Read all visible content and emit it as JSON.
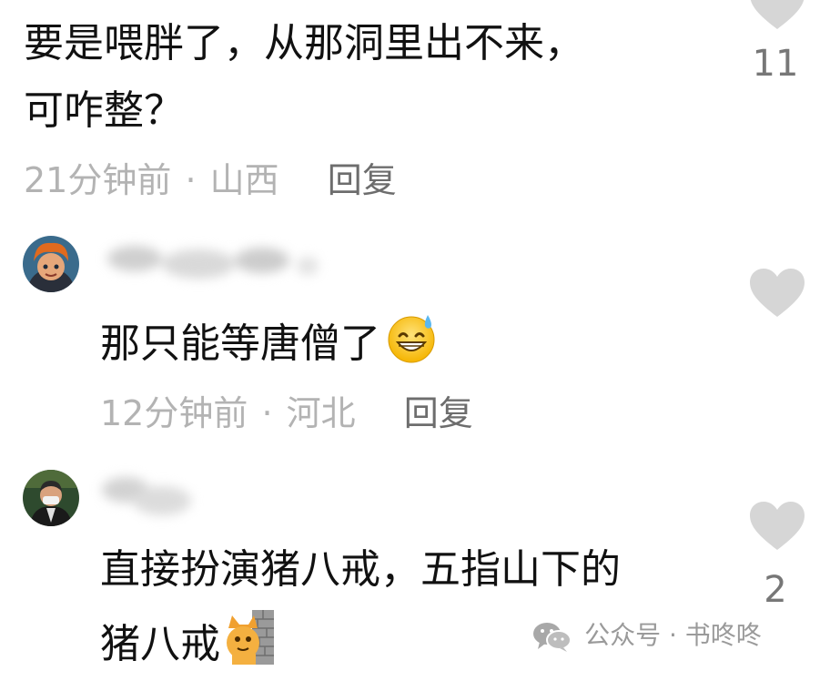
{
  "comments": [
    {
      "line1": "要是喂胖了，从那洞里出不来，",
      "line2": "可咋整？",
      "time": "21分钟前",
      "location": "山西",
      "reply_label": "回复",
      "likes": "11"
    },
    {
      "line1": "那只能等唐僧了",
      "emoji": "grinning-sweat-emoji",
      "time": "12分钟前",
      "location": "河北",
      "reply_label": "回复"
    },
    {
      "line1": "直接扮演猪八戒，五指山下的",
      "line2": "猪八戒",
      "emoji": "cat-behind-wall-emoji",
      "likes": "2"
    }
  ],
  "separator": "·",
  "watermark": {
    "icon": "wechat-icon",
    "text": "公众号 · 书咚咚"
  },
  "colors": {
    "heart": "#d6d6d6",
    "meta": "#b3b3b3",
    "reply": "#6d6d6d",
    "text": "#111111"
  }
}
